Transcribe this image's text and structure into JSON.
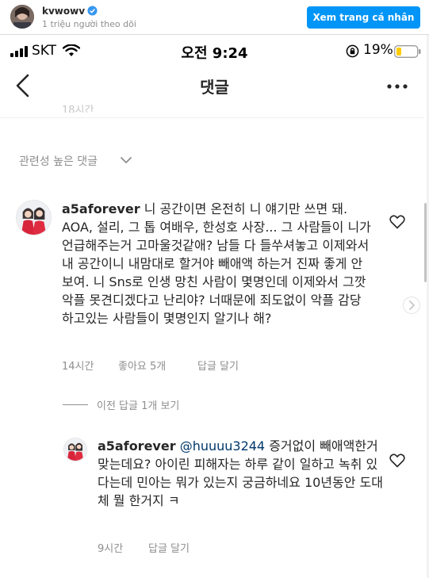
{
  "embed": {
    "username": "kvwowv",
    "followers": "1 triệu người theo dõi",
    "view_profile": "Xem trang cá nhân"
  },
  "status_bar": {
    "carrier": "SKT",
    "time": "오전 9:24",
    "battery": "19%"
  },
  "header": {
    "title": "댓글"
  },
  "prev_time": "18시간",
  "sort": {
    "label": "관련성 높은 댓글"
  },
  "comments": [
    {
      "username": "a5aforever",
      "text": "니 공간이면 온전히 니 얘기만 쓰면 돼. AOA, 설리, 그 톱 여배우, 한성호 사장... 그 사람들이 니가 언급해주는거 고마울것같애? 남들 다 들쑤셔놓고 이제와서 내 공간이니 내맘대로 할거야 빼애액 하는거 진짜 좋게 안보여. 니 Sns로 인생 망친 사람이 몇명인데 이제와서 그깟 악플 못견디겠다고 난리야? 너때문에 죄도없이 악플 감당하고있는 사람들이 몇명인지 알기나 해?",
      "time": "14시간",
      "likes": "좋아요 5개",
      "reply": "답글 달기",
      "view_replies": "이전 답글 1개 보기"
    },
    {
      "username": "a5aforever",
      "mention": "@huuuu3244",
      "text": " 증거없이 빼애액한거 맞는데요? 아이린 피해자는 하루 같이 일하고 녹취 있다는데 민아는 뭐가 있는지 궁금하네요 10년동안 도대체 뭘 한거지 ㅋ",
      "time": "9시간",
      "reply": "답글 달기"
    }
  ],
  "colors": {
    "accent": "#0095f6",
    "text": "#262626",
    "secondary": "#8e8e8e",
    "mention": "#00376b"
  }
}
